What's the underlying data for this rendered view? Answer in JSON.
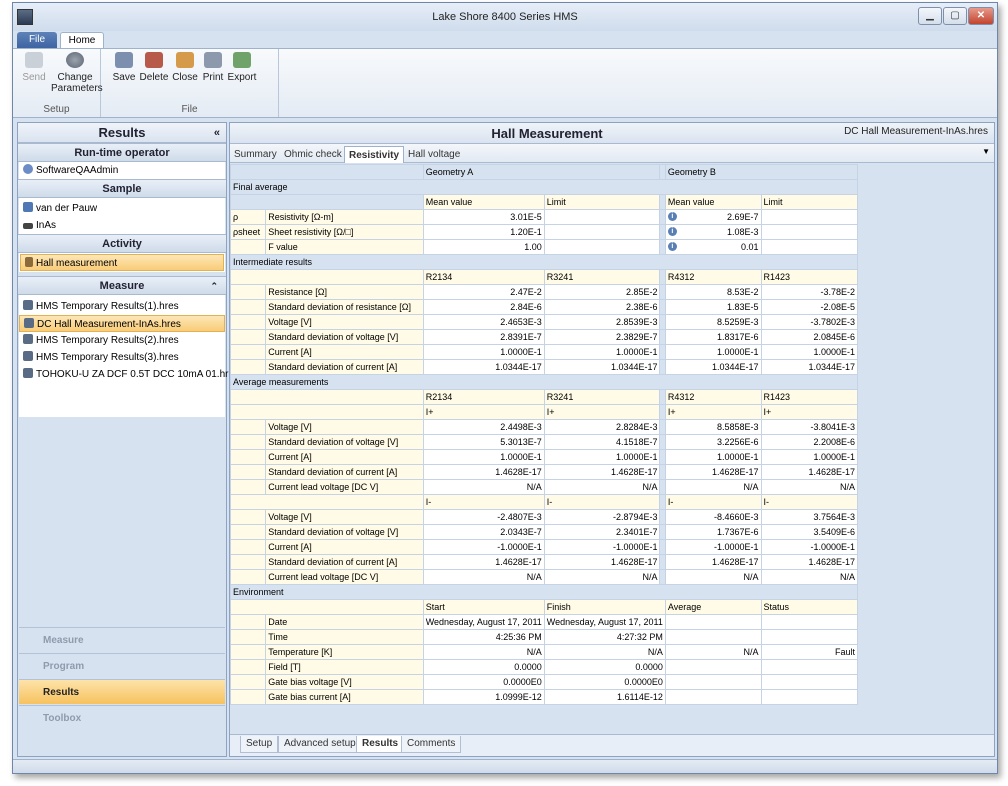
{
  "window": {
    "title": "Lake Shore 8400 Series HMS"
  },
  "ribbon": {
    "tabs": [
      {
        "label": "File"
      },
      {
        "label": "Home"
      }
    ],
    "setup_group": {
      "label": "Setup",
      "send": "Send",
      "change_params": "Change\nParameters"
    },
    "file_group": {
      "label": "File",
      "save": "Save",
      "delete": "Delete",
      "close": "Close",
      "print": "Print",
      "export": "Export"
    }
  },
  "left": {
    "title": "Results",
    "operator_head": "Run-time operator",
    "operator": "SoftwareQAAdmin",
    "sample_head": "Sample",
    "sample_items": [
      "van der Pauw",
      "InAs"
    ],
    "activity_head": "Activity",
    "activity": "Hall measurement",
    "measure_head": "Measure",
    "measure_items": [
      "HMS Temporary Results(1).hres",
      "DC Hall Measurement-InAs.hres",
      "HMS Temporary Results(2).hres",
      "HMS Temporary Results(3).hres",
      "TOHOKU-U ZA DCF 0.5T DCC 10mA 01.hres"
    ],
    "nav": [
      "Measure",
      "Program",
      "Results",
      "Toolbox"
    ]
  },
  "main": {
    "title": "Hall Measurement",
    "file": "DC Hall Measurement-InAs.hres",
    "tabs": [
      "Summary",
      "Ohmic check",
      "Resistivity",
      "Hall voltage"
    ],
    "bottom_tabs": [
      "Setup",
      "Advanced setup",
      "Results",
      "Comments"
    ],
    "geomA": "Geometry A",
    "geomB": "Geometry B",
    "final": {
      "head": "Final average",
      "mean": "Mean value",
      "limit": "Limit",
      "rows": [
        {
          "sym": "ρ",
          "label": "Resistivity [Ω-m]",
          "a": "3.01E-5",
          "b": "2.69E-7"
        },
        {
          "sym": "ρsheet",
          "label": "Sheet resistivity [Ω/□]",
          "a": "1.20E-1",
          "b": "1.08E-3"
        },
        {
          "sym": "",
          "label": "F value",
          "a": "1.00",
          "b": "0.01"
        }
      ]
    },
    "inter": {
      "head": "Intermediate results",
      "cols": [
        "R2134",
        "R3241",
        "R4312",
        "R1423"
      ],
      "rows": [
        {
          "label": "Resistance [Ω]",
          "v": [
            "2.47E-2",
            "2.85E-2",
            "8.53E-2",
            "-3.78E-2"
          ]
        },
        {
          "label": "Standard deviation of resistance [Ω]",
          "v": [
            "2.84E-6",
            "2.38E-6",
            "1.83E-5",
            "-2.08E-5"
          ]
        },
        {
          "label": "Voltage [V]",
          "v": [
            "2.4653E-3",
            "2.8539E-3",
            "8.5259E-3",
            "-3.7802E-3"
          ]
        },
        {
          "label": "Standard deviation of voltage [V]",
          "v": [
            "2.8391E-7",
            "2.3829E-7",
            "1.8317E-6",
            "2.0845E-6"
          ]
        },
        {
          "label": "Current [A]",
          "v": [
            "1.0000E-1",
            "1.0000E-1",
            "1.0000E-1",
            "1.0000E-1"
          ]
        },
        {
          "label": "Standard deviation of current [A]",
          "v": [
            "1.0344E-17",
            "1.0344E-17",
            "1.0344E-17",
            "1.0344E-17"
          ]
        }
      ]
    },
    "avg": {
      "head": "Average measurements",
      "cols": [
        "R2134",
        "R3241",
        "R4312",
        "R1423"
      ],
      "plus": "I+",
      "minus": "I-",
      "plus_rows": [
        {
          "label": "Voltage [V]",
          "v": [
            "2.4498E-3",
            "2.8284E-3",
            "8.5858E-3",
            "-3.8041E-3"
          ]
        },
        {
          "label": "Standard deviation of voltage [V]",
          "v": [
            "5.3013E-7",
            "4.1518E-7",
            "3.2256E-6",
            "2.2008E-6"
          ]
        },
        {
          "label": "Current [A]",
          "v": [
            "1.0000E-1",
            "1.0000E-1",
            "1.0000E-1",
            "1.0000E-1"
          ]
        },
        {
          "label": "Standard deviation of current [A]",
          "v": [
            "1.4628E-17",
            "1.4628E-17",
            "1.4628E-17",
            "1.4628E-17"
          ]
        },
        {
          "label": "Current lead voltage [DC V]",
          "v": [
            "N/A",
            "N/A",
            "N/A",
            "N/A"
          ]
        }
      ],
      "minus_rows": [
        {
          "label": "Voltage [V]",
          "v": [
            "-2.4807E-3",
            "-2.8794E-3",
            "-8.4660E-3",
            "3.7564E-3"
          ]
        },
        {
          "label": "Standard deviation of voltage [V]",
          "v": [
            "2.0343E-7",
            "2.3401E-7",
            "1.7367E-6",
            "3.5409E-6"
          ]
        },
        {
          "label": "Current [A]",
          "v": [
            "-1.0000E-1",
            "-1.0000E-1",
            "-1.0000E-1",
            "-1.0000E-1"
          ]
        },
        {
          "label": "Standard deviation of current [A]",
          "v": [
            "1.4628E-17",
            "1.4628E-17",
            "1.4628E-17",
            "1.4628E-17"
          ]
        },
        {
          "label": "Current lead voltage [DC V]",
          "v": [
            "N/A",
            "N/A",
            "N/A",
            "N/A"
          ]
        }
      ]
    },
    "env": {
      "head": "Environment",
      "cols": [
        "Start",
        "Finish",
        "Average",
        "Status"
      ],
      "rows": [
        {
          "label": "Date",
          "v": [
            "Wednesday, August 17, 2011",
            "Wednesday, August 17, 2011",
            "",
            ""
          ]
        },
        {
          "label": "Time",
          "v": [
            "4:25:36 PM",
            "4:27:32 PM",
            "",
            ""
          ]
        },
        {
          "label": "Temperature [K]",
          "v": [
            "N/A",
            "N/A",
            "N/A",
            "Fault"
          ]
        },
        {
          "label": "Field [T]",
          "v": [
            "0.0000",
            "0.0000",
            "",
            ""
          ]
        },
        {
          "label": "Gate bias voltage [V]",
          "v": [
            "0.0000E0",
            "0.0000E0",
            "",
            ""
          ]
        },
        {
          "label": "Gate bias current [A]",
          "v": [
            "1.0999E-12",
            "1.6114E-12",
            "",
            ""
          ]
        }
      ]
    }
  }
}
